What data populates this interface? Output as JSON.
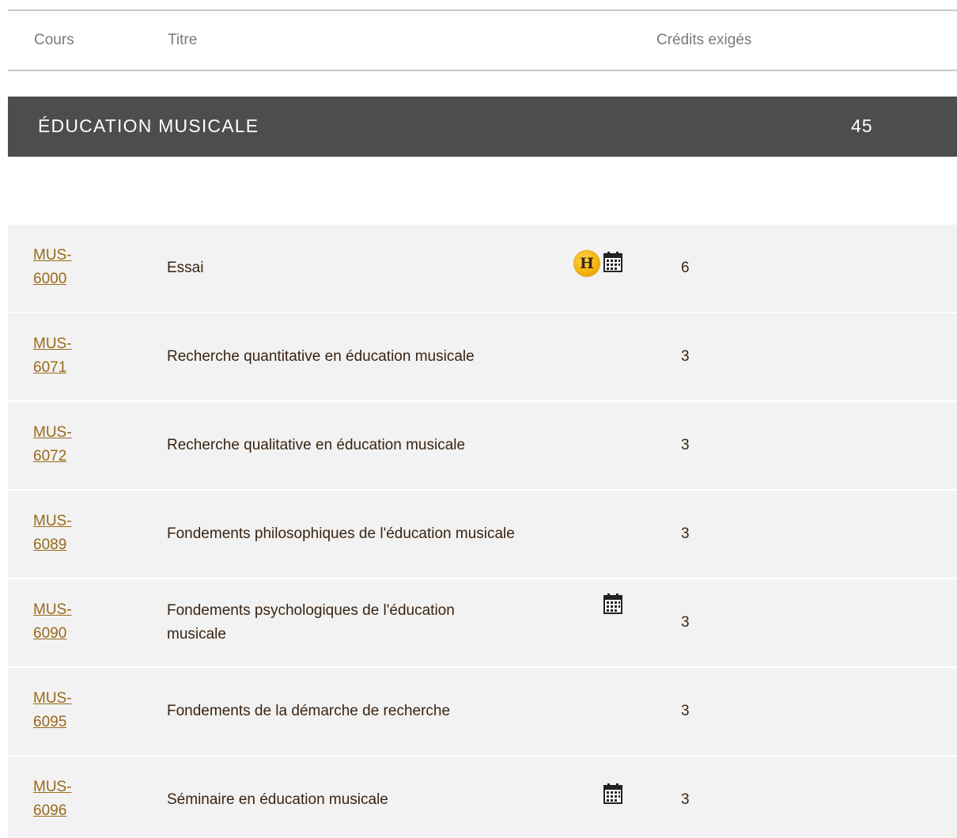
{
  "header": {
    "col_cours": "Cours",
    "col_titre": "Titre",
    "col_credits": "Crédits exigés"
  },
  "section": {
    "title": "ÉDUCATION MUSICALE",
    "credits": "45"
  },
  "courses": [
    {
      "code_line1": "MUS-",
      "code_line2": "6000",
      "title": "Essai",
      "credits": "6",
      "icons": [
        "hybrid-h-icon",
        "calendar-icon"
      ]
    },
    {
      "code_line1": "MUS-",
      "code_line2": "6071",
      "title": "Recherche quantitative en éducation musicale",
      "credits": "3",
      "icons": []
    },
    {
      "code_line1": "MUS-",
      "code_line2": "6072",
      "title": "Recherche qualitative en éducation musicale",
      "credits": "3",
      "icons": []
    },
    {
      "code_line1": "MUS-",
      "code_line2": "6089",
      "title": "Fondements philosophiques de l'éducation musicale",
      "credits": "3",
      "icons": []
    },
    {
      "code_line1": "MUS-",
      "code_line2": "6090",
      "title": "Fondements psychologiques de l'éducation musicale",
      "credits": "3",
      "icons": [
        "calendar-icon"
      ]
    },
    {
      "code_line1": "MUS-",
      "code_line2": "6095",
      "title": "Fondements de la démarche de recherche",
      "credits": "3",
      "icons": []
    },
    {
      "code_line1": "MUS-",
      "code_line2": "6096",
      "title": "Séminaire en éducation musicale",
      "credits": "3",
      "icons": [
        "calendar-icon"
      ]
    }
  ],
  "colors": {
    "section_bar": "#4d4d4d",
    "row_bg": "#f2f2f2",
    "link": "#9a6a1a",
    "hybrid_badge": "#f6b50e"
  }
}
